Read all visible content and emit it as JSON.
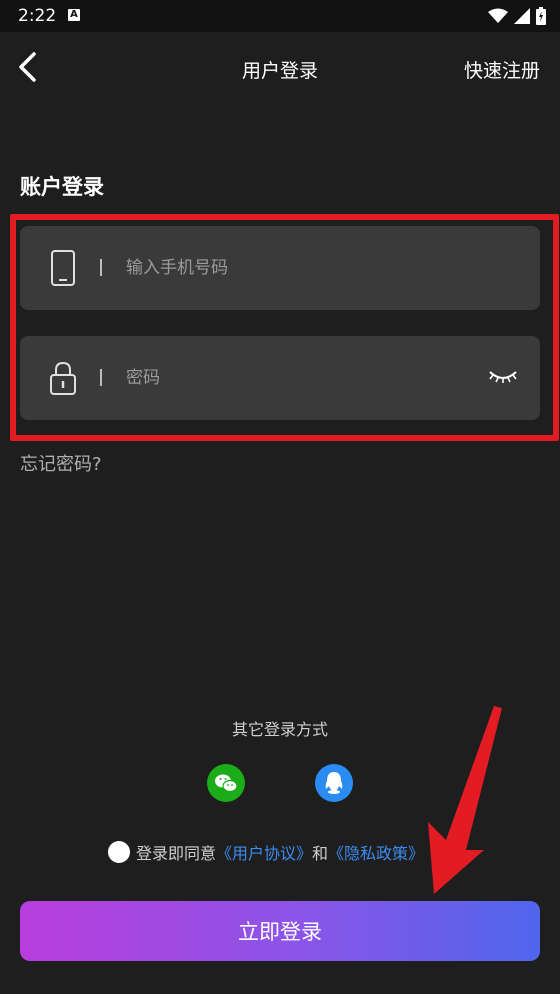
{
  "status_bar": {
    "time": "2:22",
    "notification_letter": "A"
  },
  "nav": {
    "title": "用户登录",
    "register_label": "快速注册"
  },
  "form": {
    "section_title": "账户登录",
    "phone_placeholder": "输入手机号码",
    "password_placeholder": "密码",
    "forgot_label": "忘记密码?"
  },
  "social": {
    "title": "其它登录方式",
    "providers": [
      "wechat",
      "qq"
    ]
  },
  "agreement": {
    "prefix": "登录即同意",
    "user_agreement": "《用户协议》",
    "conjunction": "和",
    "privacy_policy": "《隐私政策》"
  },
  "login_button": {
    "label": "立即登录"
  },
  "colors": {
    "background": "#1e1e1e",
    "field_bg": "#3a3a3a",
    "highlight": "#e31b23",
    "link": "#3b8cf0",
    "gradient_start": "#b83ddc",
    "gradient_end": "#4f66ec",
    "wechat": "#1aad19",
    "qq": "#2a8cf0"
  }
}
